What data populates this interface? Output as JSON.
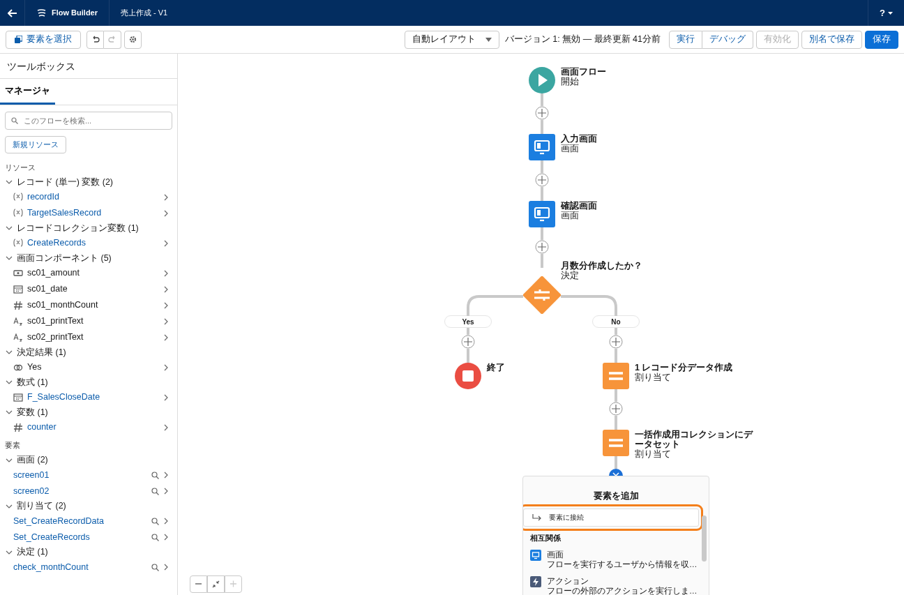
{
  "header": {
    "app_name": "Flow Builder",
    "flow_title": "売上作成 - V1",
    "help_label": "?"
  },
  "toolbar": {
    "select_button": "要素を選択",
    "history": [
      {
        "kind": "undo",
        "disabled": false
      },
      {
        "kind": "redo",
        "disabled": true
      }
    ],
    "layout_select": {
      "value": "自動レイアウト"
    },
    "version_status": "バージョン 1: 無効 — 最終更新 41分前",
    "buttons": [
      {
        "label": "実行",
        "kind": "grouped",
        "disabled": false
      },
      {
        "label": "デバッグ",
        "kind": "grouped",
        "disabled": false
      },
      {
        "label": "有効化",
        "kind": "neutral",
        "disabled": true
      },
      {
        "label": "別名で保存",
        "kind": "neutral",
        "disabled": false
      },
      {
        "label": "保存",
        "kind": "brand",
        "disabled": false
      }
    ]
  },
  "sidebar": {
    "title": "ツールボックス",
    "tabs": [
      {
        "label": "マネージャ",
        "selected": true
      }
    ],
    "search": {
      "placeholder": "このフローを検索..."
    },
    "new_resource_button": "新規リソース",
    "sections": [
      {
        "title": "リソース",
        "groups": [
          {
            "title": "レコード (単一) 変数 (2)",
            "expanded": true,
            "items": [
              {
                "kind": "record",
                "label": "recordId",
                "link": true
              },
              {
                "kind": "record",
                "label": "TargetSalesRecord",
                "link": true
              }
            ]
          },
          {
            "title": "レコードコレクション変数 (1)",
            "expanded": true,
            "items": [
              {
                "kind": "record",
                "label": "CreateRecords",
                "link": true
              }
            ]
          },
          {
            "title": "画面コンポーネント (5)",
            "expanded": true,
            "items": [
              {
                "kind": "currency",
                "label": "sc01_amount",
                "link": false
              },
              {
                "kind": "date",
                "label": "sc01_date",
                "link": false
              },
              {
                "kind": "number",
                "label": "sc01_monthCount",
                "link": false
              },
              {
                "kind": "text",
                "label": "sc01_printText",
                "link": false
              },
              {
                "kind": "text",
                "label": "sc02_printText",
                "link": false
              }
            ]
          },
          {
            "title": "決定結果 (1)",
            "expanded": true,
            "items": [
              {
                "kind": "outcome",
                "label": "Yes",
                "link": false
              }
            ]
          },
          {
            "title": "数式 (1)",
            "expanded": true,
            "items": [
              {
                "kind": "date",
                "label": "F_SalesCloseDate",
                "link": true
              }
            ]
          },
          {
            "title": "変数 (1)",
            "expanded": true,
            "items": [
              {
                "kind": "number",
                "label": "counter",
                "link": true
              }
            ]
          }
        ]
      },
      {
        "title": "要素",
        "groups": [
          {
            "title": "画面 (2)",
            "expanded": true,
            "items": [
              {
                "kind": "element",
                "label": "screen01",
                "link": true
              },
              {
                "kind": "element",
                "label": "screen02",
                "link": true
              }
            ]
          },
          {
            "title": "割り当て (2)",
            "expanded": true,
            "items": [
              {
                "kind": "element",
                "label": "Set_CreateRecordData",
                "link": true
              },
              {
                "kind": "element",
                "label": "Set_CreateRecords",
                "link": true
              }
            ]
          },
          {
            "title": "決定 (1)",
            "expanded": true,
            "items": [
              {
                "kind": "element",
                "label": "check_monthCount",
                "link": true
              }
            ]
          }
        ]
      }
    ]
  },
  "canvas": {
    "flow": [
      {
        "kind": "start",
        "title": "画面フロー",
        "subtitle": "開始"
      },
      {
        "kind": "screen",
        "title": "入力画面",
        "subtitle": "画面"
      },
      {
        "kind": "screen",
        "title": "確認画面",
        "subtitle": "画面"
      },
      {
        "kind": "decision",
        "title": "月数分作成したか？",
        "subtitle": "決定",
        "branches": [
          {
            "label": "Yes",
            "nodes": [
              {
                "kind": "end",
                "title": "終了"
              }
            ]
          },
          {
            "label": "No",
            "nodes": [
              {
                "kind": "assignment",
                "title": "1 レコード分データ作成",
                "subtitle": "割り当て"
              },
              {
                "kind": "assignment",
                "title": "一括作成用コレクションにデータセット",
                "subtitle": "割り当て"
              }
            ],
            "add_menu": {
              "title": "要素を追加",
              "connect_option": {
                "label": "要素に接続",
                "highlighted": true
              },
              "section_title": "相互関係",
              "items": [
                {
                  "kind": "screen",
                  "label": "画面",
                  "description": "フローを実行するユーザから情報を収…"
                },
                {
                  "kind": "action",
                  "label": "アクション",
                  "description": "フローの外部のアクションを実行しま…"
                }
              ]
            }
          }
        ]
      }
    ],
    "zoom_controls": [
      {
        "kind": "zoom-out",
        "disabled": false
      },
      {
        "kind": "fit",
        "disabled": false
      },
      {
        "kind": "zoom-in",
        "disabled": true
      }
    ]
  }
}
